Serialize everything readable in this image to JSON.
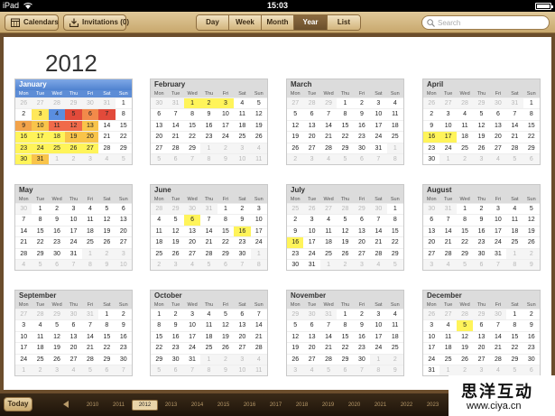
{
  "status": {
    "carrier": "iPad",
    "time": "15:03"
  },
  "toolbar": {
    "calendars_label": "Calendars",
    "invitations_label": "Invitations (0)",
    "tabs": [
      {
        "label": "Day",
        "active": false
      },
      {
        "label": "Week",
        "active": false
      },
      {
        "label": "Month",
        "active": false
      },
      {
        "label": "Year",
        "active": true
      },
      {
        "label": "List",
        "active": false
      }
    ],
    "search_placeholder": "Search"
  },
  "calendar": {
    "year": "2012",
    "weekdays": [
      "Mon",
      "Tue",
      "Wed",
      "Thu",
      "Fri",
      "Sat",
      "Sun"
    ],
    "highlight_color": "#fff45a",
    "current_month_header_color": "#4f82d0",
    "months": [
      {
        "name": "January",
        "lead": 6,
        "days": 31,
        "prev_days": 31,
        "current": true,
        "highlights": [
          3,
          4,
          5,
          6,
          7,
          9,
          10,
          11,
          12,
          13,
          16,
          17,
          18,
          19,
          20,
          23,
          24,
          25,
          26,
          27,
          30,
          31
        ],
        "cell_colors": {
          "3": "#ffe85a",
          "4": "#5a8ee0",
          "5": "#e24a3a",
          "6": "#f28a4a",
          "7": "#e24a3a",
          "9": "#f2a34a",
          "10": "#f9c44a",
          "11": "#f06a4a",
          "12": "#f06a4a",
          "13": "#f9c44a",
          "16": "#fff45a",
          "17": "#fff45a",
          "18": "#fff45a",
          "19": "#f9c44a",
          "20": "#f9c44a",
          "23": "#fff45a",
          "24": "#fff45a",
          "25": "#fff45a",
          "26": "#fff45a",
          "27": "#fff45a",
          "30": "#fff45a",
          "31": "#f9c44a"
        }
      },
      {
        "name": "February",
        "lead": 2,
        "days": 29,
        "prev_days": 31,
        "highlights": [
          1,
          2,
          3
        ]
      },
      {
        "name": "March",
        "lead": 3,
        "days": 31,
        "prev_days": 29,
        "highlights": []
      },
      {
        "name": "April",
        "lead": 6,
        "days": 30,
        "prev_days": 31,
        "highlights": [
          16,
          17
        ]
      },
      {
        "name": "May",
        "lead": 1,
        "days": 31,
        "prev_days": 30,
        "highlights": []
      },
      {
        "name": "June",
        "lead": 4,
        "days": 30,
        "prev_days": 31,
        "highlights": [
          6,
          16
        ]
      },
      {
        "name": "July",
        "lead": 6,
        "days": 31,
        "prev_days": 30,
        "highlights": [
          16
        ]
      },
      {
        "name": "August",
        "lead": 2,
        "days": 31,
        "prev_days": 31,
        "highlights": []
      },
      {
        "name": "September",
        "lead": 5,
        "days": 30,
        "prev_days": 31,
        "highlights": []
      },
      {
        "name": "October",
        "lead": 0,
        "days": 31,
        "prev_days": 30,
        "highlights": []
      },
      {
        "name": "November",
        "lead": 3,
        "days": 30,
        "prev_days": 31,
        "highlights": []
      },
      {
        "name": "December",
        "lead": 5,
        "days": 31,
        "prev_days": 30,
        "highlights": [
          5
        ]
      }
    ]
  },
  "bottom": {
    "today_label": "Today",
    "years": [
      "2010",
      "2011",
      "2012",
      "2013",
      "2014",
      "2015",
      "2016",
      "2017",
      "2018",
      "2019",
      "2020",
      "2021",
      "2022",
      "2023"
    ],
    "active_year": "2012"
  },
  "watermark": {
    "text_cn": "思洋互动",
    "url": "www.ciya.cn"
  }
}
